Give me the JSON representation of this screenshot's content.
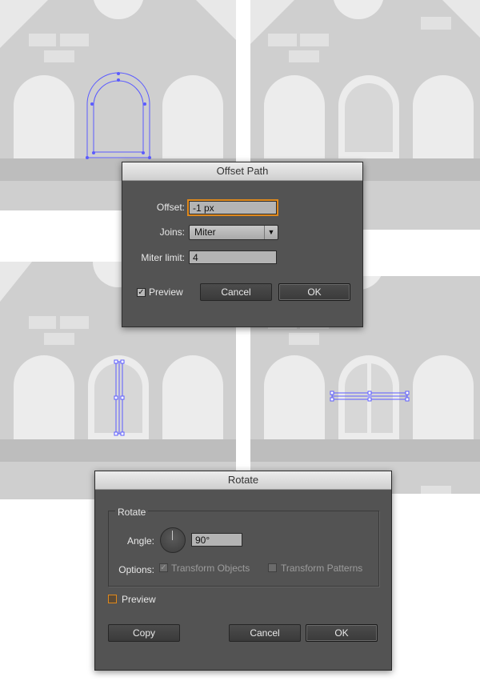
{
  "offset_path": {
    "title": "Offset Path",
    "offset_label": "Offset:",
    "offset_value": "-1 px",
    "joins_label": "Joins:",
    "joins_value": "Miter",
    "miter_label": "Miter limit:",
    "miter_value": "4",
    "preview_label": "Preview",
    "preview_checked": true,
    "cancel_label": "Cancel",
    "ok_label": "OK",
    "check_glyph": "✓",
    "select_arrow": "▼"
  },
  "rotate": {
    "title": "Rotate",
    "group_label": "Rotate",
    "angle_label": "Angle:",
    "angle_value": "90°",
    "options_label": "Options:",
    "transform_objects_label": "Transform Objects",
    "transform_objects_checked": true,
    "transform_patterns_label": "Transform Patterns",
    "transform_patterns_checked": false,
    "preview_label": "Preview",
    "preview_checked": false,
    "copy_label": "Copy",
    "cancel_label": "Cancel",
    "ok_label": "OK",
    "check_glyph": "✓"
  },
  "colors": {
    "selection": "#5b5bff",
    "focus": "#e0891c",
    "dialog_bg": "#535353",
    "wall": "#cfcfcf",
    "window": "#ececec"
  }
}
